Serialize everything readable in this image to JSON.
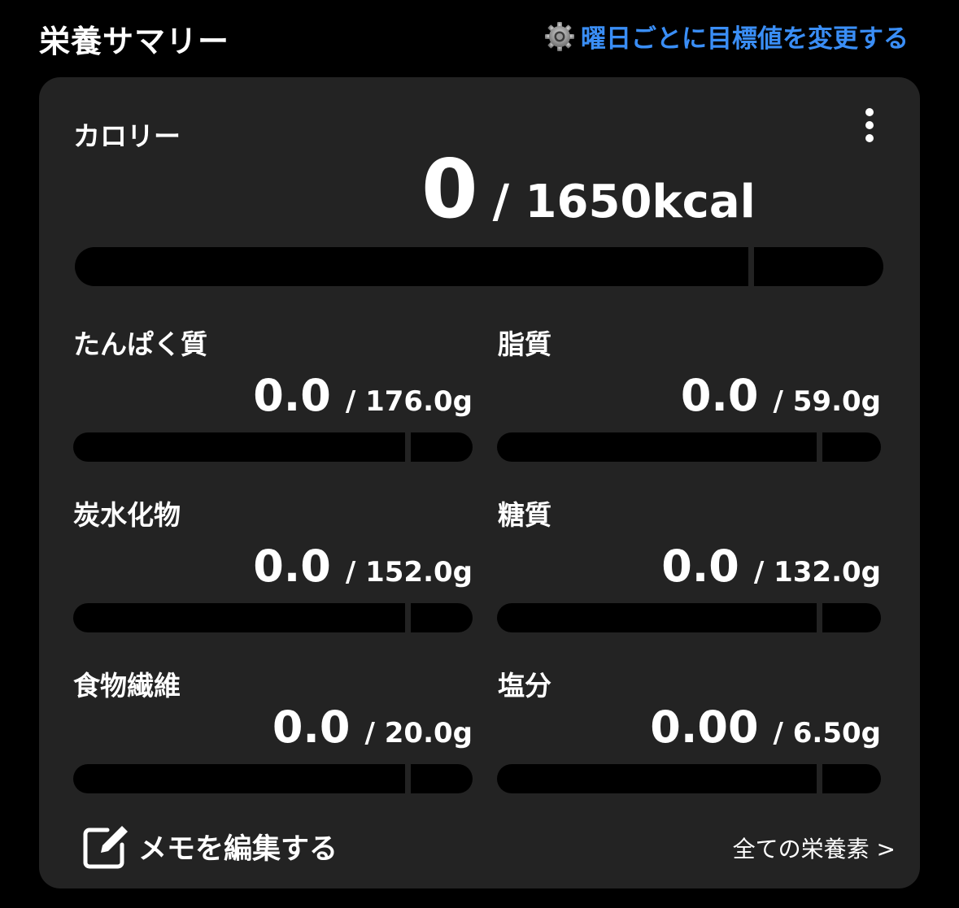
{
  "header": {
    "title": "栄養サマリー",
    "settings_link": "曜日ごとに目標値を変更する",
    "settings_icon": "gear-icon"
  },
  "calorie": {
    "label": "カロリー",
    "current": "0",
    "target": "/ 1650kcal",
    "progress": 0
  },
  "nutrients": [
    {
      "key": "protein",
      "label": "たんぱく質",
      "current": "0.0",
      "target": "/ 176.0g",
      "progress": 0
    },
    {
      "key": "fat",
      "label": "脂質",
      "current": "0.0",
      "target": "/ 59.0g",
      "progress": 0
    },
    {
      "key": "carbs",
      "label": "炭水化物",
      "current": "0.0",
      "target": "/ 152.0g",
      "progress": 0
    },
    {
      "key": "sugar",
      "label": "糖質",
      "current": "0.0",
      "target": "/ 132.0g",
      "progress": 0
    },
    {
      "key": "fiber",
      "label": "食物繊維",
      "current": "0.0",
      "target": "/ 20.0g",
      "progress": 0
    },
    {
      "key": "salt",
      "label": "塩分",
      "current": "0.00",
      "target": "/ 6.50g",
      "progress": 0
    }
  ],
  "footer": {
    "memo_label": "メモを編集する",
    "memo_icon": "edit-icon",
    "all_nutrients_link": "全ての栄養素 >"
  },
  "colors": {
    "background": "#000000",
    "card": "#232323",
    "accent": "#3a8ef6",
    "bar_track": "#000000",
    "text": "#ffffff"
  }
}
